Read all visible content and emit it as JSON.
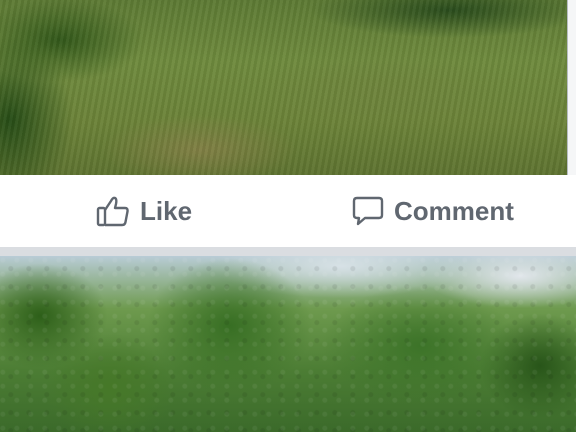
{
  "post": {
    "photo_top": {
      "description_icon": "photo-image"
    },
    "actions": {
      "like_label": "Like",
      "comment_label": "Comment",
      "like_icon": "thumbs-up-icon",
      "comment_icon": "speech-bubble-icon"
    },
    "photo_bottom": {
      "description_icon": "photo-image"
    }
  },
  "colors": {
    "action_text": "#606770",
    "background": "#e9ebee",
    "card": "#ffffff"
  }
}
